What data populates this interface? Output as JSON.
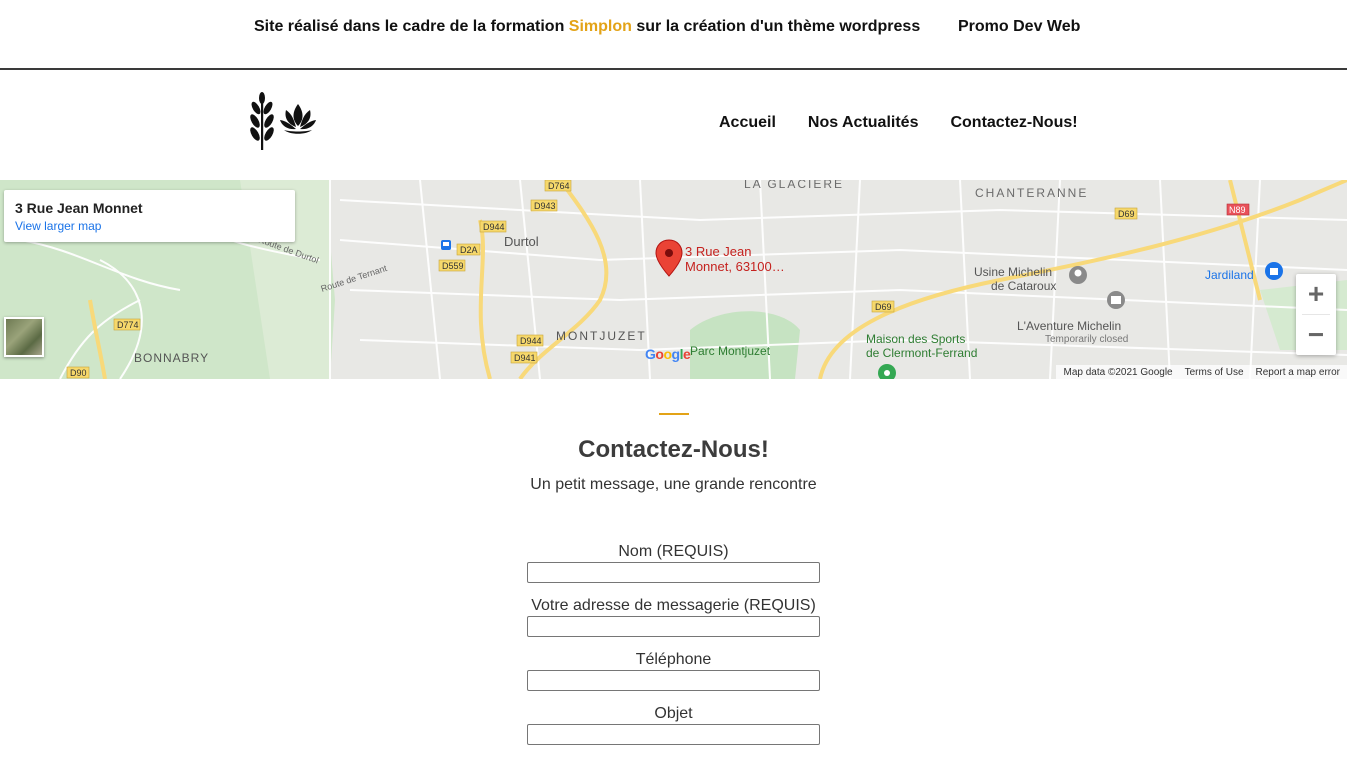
{
  "topbar": {
    "text_before": "Site réalisé dans le cadre de la formation ",
    "text_accent": "Simplon",
    "text_after": " sur la création d'un thème wordpress",
    "promo": "Promo Dev Web"
  },
  "nav": {
    "items": [
      "Accueil",
      "Nos Actualités",
      "Contactez-Nous!"
    ]
  },
  "map": {
    "card_title": "3 Rue Jean Monnet",
    "card_link": "View larger map",
    "marker_label_1": "3 Rue Jean",
    "marker_label_2": "Monnet, 63100…",
    "places": {
      "la_glaciere": "LA GLACIERE",
      "chanteranne": "CHANTERANNE",
      "durtol": "Durtol",
      "montjuzet": "MONTJUZET",
      "bonnabry": "BONNABRY",
      "parc": "Parc Montjuzet",
      "usine_1": "Usine Michelin",
      "usine_2": "de Cataroux",
      "jardiland": "Jardiland",
      "aventure_1": "L'Aventure Michelin",
      "aventure_2": "Temporarily closed",
      "maison_1": "Maison des Sports",
      "maison_2": "de Clermont-Ferrand",
      "route_durtol": "Route de Durtol",
      "route_ternant": "Route de Ternant"
    },
    "roads": [
      "D764",
      "D943",
      "D944",
      "D2A",
      "D559",
      "D774",
      "D90",
      "D944",
      "D941",
      "D69",
      "D69",
      "N89"
    ],
    "google": "Google",
    "footer": [
      "Map data ©2021 Google",
      "Terms of Use",
      "Report a map error"
    ],
    "zoom_in": "+",
    "zoom_out": "−"
  },
  "contact": {
    "title": "Contactez-Nous!",
    "subtitle": "Un petit message, une grande rencontre",
    "fields": [
      {
        "label": "Nom (REQUIS)",
        "value": ""
      },
      {
        "label": "Votre adresse de messagerie (REQUIS)",
        "value": ""
      },
      {
        "label": "Téléphone",
        "value": ""
      },
      {
        "label": "Objet",
        "value": ""
      }
    ]
  },
  "colors": {
    "accent": "#e3a317",
    "text": "#111111",
    "heading": "#3c3c3c",
    "link": "#1a73e8",
    "marker": "#ea4335"
  }
}
